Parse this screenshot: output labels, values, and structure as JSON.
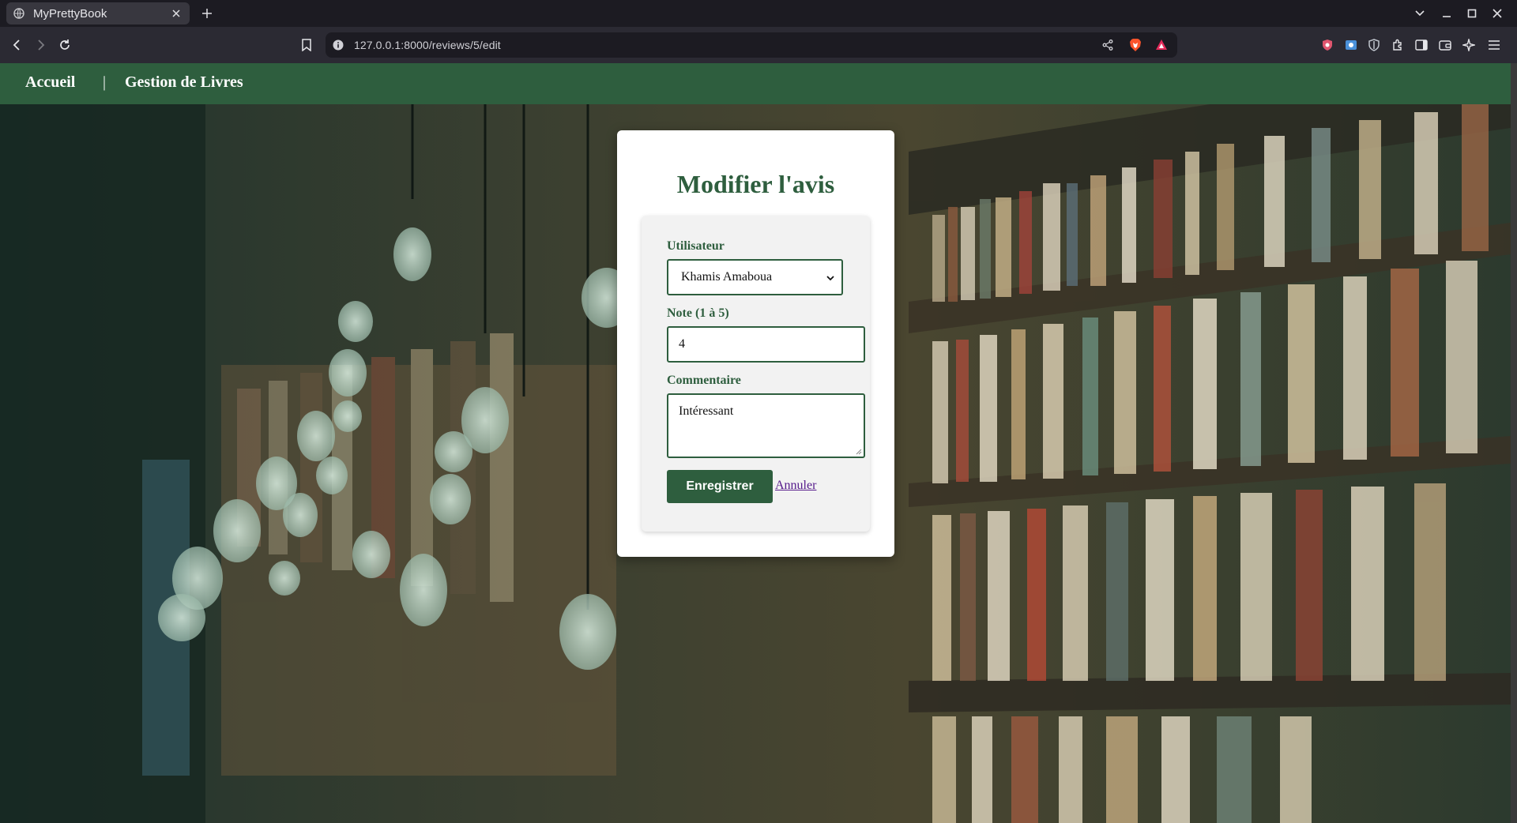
{
  "browser": {
    "tab_title": "MyPrettyBook",
    "url": "127.0.0.1:8000/reviews/5/edit"
  },
  "navbar": {
    "home_label": "Accueil",
    "separator": "|",
    "books_label": "Gestion de Livres"
  },
  "form": {
    "title": "Modifier l'avis",
    "user_label": "Utilisateur",
    "user_selected": "Khamis Amaboua",
    "rating_label": "Note (1 à 5)",
    "rating_value": "4",
    "comment_label": "Commentaire",
    "comment_value": "Intéressant",
    "save_label": "Enregistrer",
    "cancel_label": "Annuler"
  },
  "colors": {
    "brand_green": "#2e5e3e",
    "link_visited": "#551a8b"
  }
}
